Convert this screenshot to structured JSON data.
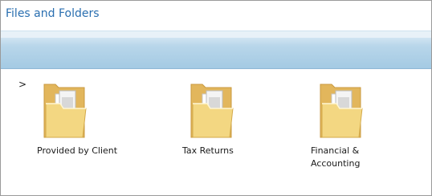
{
  "header": {
    "title": "Files and Folders"
  },
  "breadcrumb": {
    "arrow": ">"
  },
  "folders": [
    {
      "name": "Provided by Client",
      "icon": "folder-icon"
    },
    {
      "name": "Tax Returns",
      "icon": "folder-icon"
    },
    {
      "name": "Financial &",
      "name_line2": "Accounting",
      "icon": "folder-icon"
    }
  ],
  "colors": {
    "title": "#2a6fb0",
    "toolbar": "#a4cae3",
    "folder_body": "#f2d27a",
    "folder_back": "#e0b55a"
  }
}
